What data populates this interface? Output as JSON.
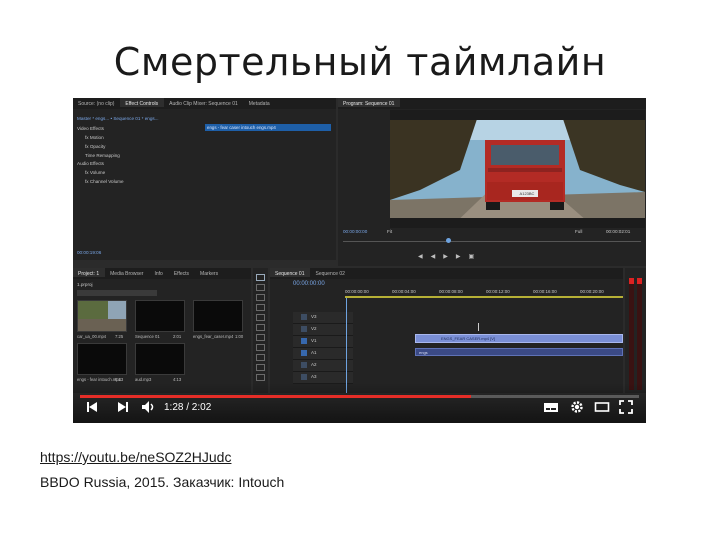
{
  "slide": {
    "title": "Смертельный таймлайн",
    "link": "https://youtu.be/neSOZ2HJudc",
    "caption": "BBDO Russia, 2015. Заказчик: Intouch"
  },
  "effect_controls": {
    "tabs": [
      "Source: (no clip)",
      "Effect Controls",
      "Audio Clip Mixer: Sequence 01",
      "Metadata"
    ],
    "source_label": "Master * engs... • Sequence 01 * engs...",
    "clip_bar": "engs - fear caser intouch engs.mp4",
    "rows": [
      "Video Effects",
      "fx Motion",
      "fx Opacity",
      "Time Remapping",
      "Audio Effects",
      "fx Volume",
      "fx Channel Volume"
    ],
    "timecode": "00:00:19:06"
  },
  "program": {
    "title": "Program: Sequence 01",
    "timecode_left": "00:00:00:00",
    "fit": "Fit",
    "quality": "Full",
    "timecode_right": "00:00:02:01",
    "plate": "A123BC"
  },
  "project": {
    "tabs": [
      "Project: 1",
      "Media Browser",
      "Info",
      "Effects",
      "Markers"
    ],
    "name": "1.prproj",
    "items": [
      {
        "name": "car_ua_00.mp4",
        "duration": "7:25"
      },
      {
        "name": "Sequence 01",
        "duration": "2:01"
      },
      {
        "name": "engs_fear_caser.mp4",
        "duration": "1:00"
      },
      {
        "name": "aud.mp3",
        "duration": "4:13"
      },
      {
        "name": "engs - fear intouch.mp4",
        "duration": "0:13"
      }
    ]
  },
  "timeline": {
    "tabs": [
      "Sequence 01",
      "Sequence 02"
    ],
    "timecode": "00:00:00:00",
    "ruler": [
      "00:00:00:00",
      "00:00:04:00",
      "00:00:08:00",
      "00:00:12:00",
      "00:00:16:00",
      "00:00:20:00"
    ],
    "tracks": [
      "V3",
      "V2",
      "V1",
      "A1",
      "A2",
      "A3"
    ],
    "clip_label": "ENGS_FEAR CASER.mp4 [V]",
    "audio_clip": "engs"
  },
  "player": {
    "time": "1:28 / 2:02",
    "progress": 0.7,
    "colors": {
      "progress": "#e52d27",
      "accent": "#1e5fa8"
    }
  }
}
